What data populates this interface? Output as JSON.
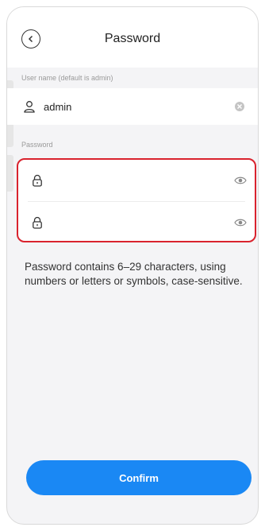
{
  "header": {
    "title": "Password",
    "back_icon": "chevron-left-icon"
  },
  "username": {
    "label": "User name (default is admin)",
    "value": "admin",
    "lead_icon": "user-icon",
    "clear_icon": "clear-icon"
  },
  "password": {
    "label": "Password",
    "fields": [
      {
        "value": "",
        "lead_icon": "lock-icon",
        "toggle_icon": "eye-icon"
      },
      {
        "value": "",
        "lead_icon": "lock-icon",
        "toggle_icon": "eye-icon"
      }
    ],
    "highlight_color": "#d9232e"
  },
  "hint": "Password contains 6–29 characters, using numbers or letters or symbols, case-sensitive.",
  "confirm": {
    "label": "Confirm",
    "color": "#1a88f4"
  }
}
